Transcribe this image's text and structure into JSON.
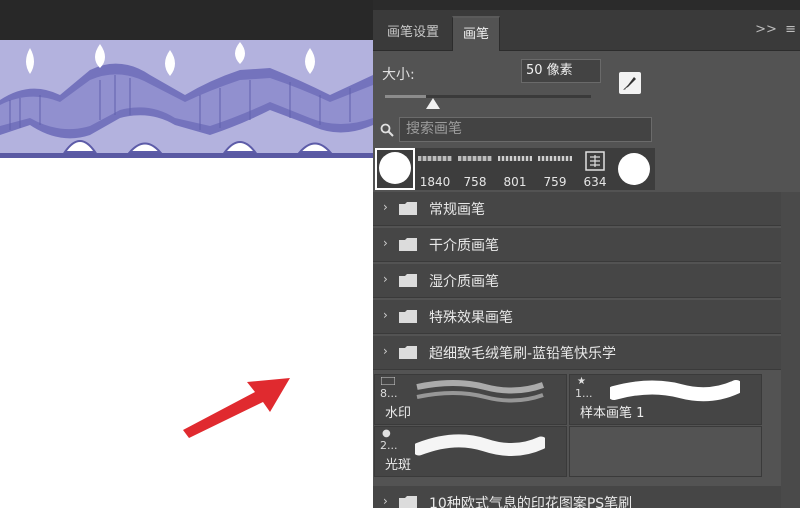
{
  "panel": {
    "tabs": [
      {
        "label": "画笔设置"
      },
      {
        "label": "画笔"
      }
    ],
    "menu_icons": [
      "expand-icon",
      "menu-icon"
    ]
  },
  "size": {
    "label": "大小:",
    "value": "50 像素",
    "slider_fraction": 0.2
  },
  "search": {
    "placeholder": "搜索画笔"
  },
  "presets": [
    {
      "num": ""
    },
    {
      "num": "1840"
    },
    {
      "num": "758"
    },
    {
      "num": "801"
    },
    {
      "num": "759"
    },
    {
      "num": "634"
    },
    {
      "num": ""
    }
  ],
  "groups": [
    {
      "label": "常规画笔"
    },
    {
      "label": "干介质画笔"
    },
    {
      "label": "湿介质画笔"
    },
    {
      "label": "特殊效果画笔"
    },
    {
      "label": "超细致毛绒笔刷-蓝铅笔快乐学"
    },
    {
      "label": "10种欧式气息的印花图案PS笔刷"
    }
  ],
  "brushes": [
    {
      "num": "8...",
      "label": "水印"
    },
    {
      "num": "1...",
      "label": "样本画笔 1"
    },
    {
      "num": "2...",
      "label": "光斑"
    }
  ],
  "colors": {
    "panel_bg": "#535353",
    "accent_border": "#9a9ad0",
    "arrow": "#e02a2f"
  }
}
